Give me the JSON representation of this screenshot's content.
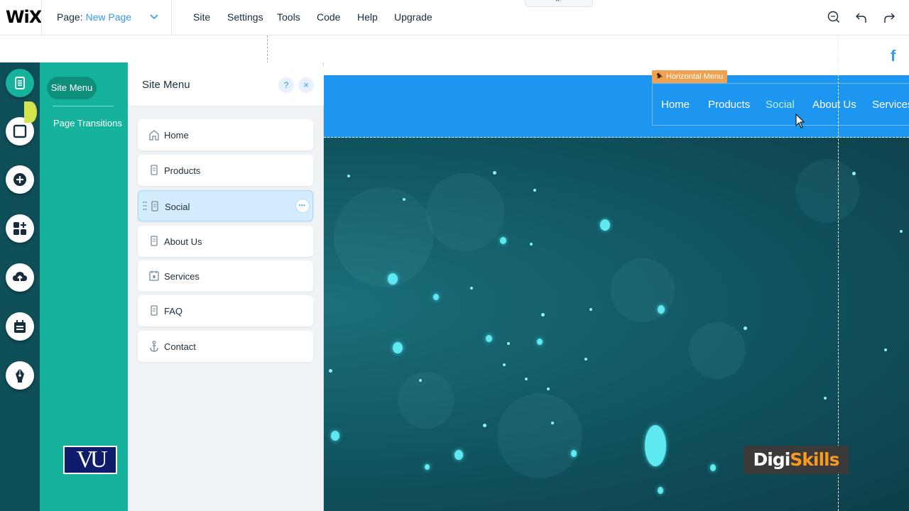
{
  "topbar": {
    "logo": "WiX",
    "page_label": "Page:",
    "page_name": "New Page",
    "menu": [
      "Site",
      "Settings",
      "Tools",
      "Code",
      "Help",
      "Upgrade"
    ],
    "collapse_tab_glyph": "×",
    "tools": [
      "zoom-icon",
      "undo-icon",
      "redo-icon"
    ]
  },
  "left_rail": {
    "buttons": [
      "pages-icon",
      "background-icon",
      "add-icon",
      "app-market-icon",
      "upload-icon",
      "blog-icon",
      "pen-icon"
    ]
  },
  "pages_nav": {
    "site_menu": "Site Menu",
    "page_transitions": "Page Transitions",
    "vu_logo": "VU"
  },
  "panel": {
    "title": "Site Menu",
    "help": "?",
    "close": "×",
    "pages": [
      {
        "label": "Home",
        "icon": "home-icon"
      },
      {
        "label": "Products",
        "icon": "page-icon"
      },
      {
        "label": "Social",
        "icon": "page-icon",
        "selected": true
      },
      {
        "label": "About Us",
        "icon": "page-icon"
      },
      {
        "label": "Services",
        "icon": "calendar-icon"
      },
      {
        "label": "FAQ",
        "icon": "page-icon"
      },
      {
        "label": "Contact",
        "icon": "anchor-icon"
      }
    ]
  },
  "site": {
    "facebook": "f",
    "hmenu_tag": "Horizontal Menu",
    "hmenu_items": [
      "Home",
      "Products",
      "Social",
      "About Us",
      "Services"
    ],
    "hmenu_active": "Social",
    "colors": {
      "header": "#1c96f0",
      "panel_accent": "#15b39c",
      "link": "#3899ec"
    }
  },
  "watermark": {
    "part1": "Digi",
    "part2": "Skills"
  }
}
